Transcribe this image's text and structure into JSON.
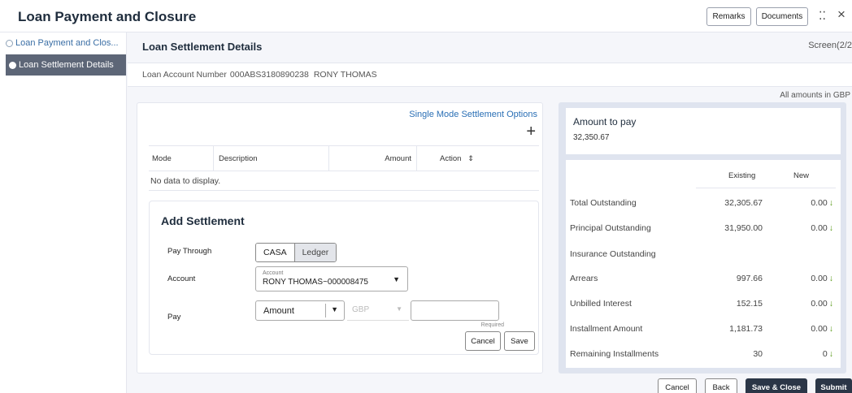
{
  "header": {
    "title": "Loan Payment and Closure",
    "remarks_label": "Remarks",
    "documents_label": "Documents",
    "minimize_glyph": "⁚⁚",
    "close_glyph": "×"
  },
  "sidebar": {
    "items": [
      {
        "label": "Loan Payment and Clos...",
        "state": "done"
      },
      {
        "label": "Loan Settlement Details",
        "state": "current"
      }
    ]
  },
  "main": {
    "section_title": "Loan Settlement Details",
    "screen_indicator": "Screen(2/2",
    "account": {
      "label": "Loan Account Number",
      "number": "000ABS3180890238",
      "name": "RONY THOMAS"
    },
    "amounts_note": "All amounts in GBP"
  },
  "settlement": {
    "single_mode_link": "Single Mode Settlement Options",
    "add_glyph": "+",
    "table": {
      "columns": [
        "Mode",
        "Description",
        "Amount",
        "Action"
      ],
      "sort_glyph": "⇕",
      "empty_text": "No data to display."
    },
    "add_settlement": {
      "title": "Add Settlement",
      "pay_through_label": "Pay Through",
      "pay_through_options": [
        "CASA",
        "Ledger"
      ],
      "pay_through_selected": "CASA",
      "account_label": "Account",
      "account_field_label": "Account",
      "account_value": "RONY THOMAS~000008475",
      "pay_label": "Pay",
      "pay_type_value": "Amount",
      "currency_value": "GBP",
      "amount_value": "",
      "required_note": "Required",
      "cancel_label": "Cancel",
      "save_label": "Save"
    }
  },
  "summary": {
    "amount_to_pay_label": "Amount to pay",
    "amount_to_pay_value": "32,350.67",
    "columns": {
      "existing": "Existing",
      "new": "New"
    },
    "rows": [
      {
        "label": "Total Outstanding",
        "existing": "32,305.67",
        "new": "0.00",
        "arrow": "↓"
      },
      {
        "label": "Principal Outstanding",
        "existing": "31,950.00",
        "new": "0.00",
        "arrow": "↓"
      },
      {
        "label": "Insurance Outstanding",
        "existing": "",
        "new": "",
        "arrow": ""
      },
      {
        "label": "Arrears",
        "existing": "997.66",
        "new": "0.00",
        "arrow": "↓"
      },
      {
        "label": "Unbilled Interest",
        "existing": "152.15",
        "new": "0.00",
        "arrow": "↓"
      },
      {
        "label": "Installment Amount",
        "existing": "1,181.73",
        "new": "0.00",
        "arrow": "↓"
      },
      {
        "label": "Remaining Installments",
        "existing": "30",
        "new": "0",
        "arrow": "↓"
      }
    ]
  },
  "footer": {
    "cancel_label": "Cancel",
    "back_label": "Back",
    "save_close_label": "Save & Close",
    "submit_label": "Submit"
  },
  "colors": {
    "sidebar_active": "#5d6677",
    "primary_button": "#2b3647",
    "link": "#2a6fb5",
    "down_arrow": "#5a9a1a",
    "summary_panel": "#dfe4ef"
  }
}
